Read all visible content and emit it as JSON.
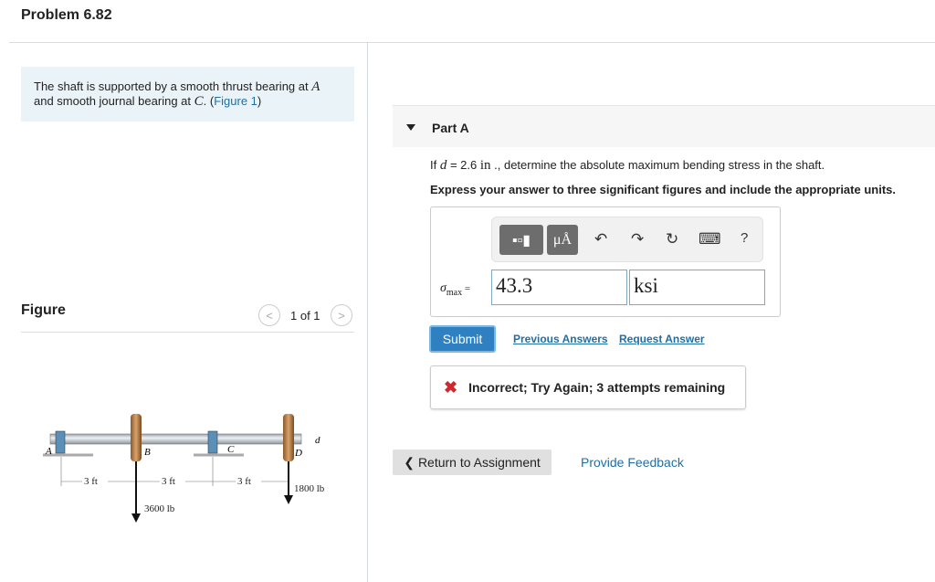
{
  "header": {
    "title": "Problem 6.82"
  },
  "intro": {
    "text_1": "The shaft is supported by a smooth thrust bearing at ",
    "A": "A",
    "text_2": " and smooth journal bearing at ",
    "C": "C",
    "text_3": ". (",
    "figure_link": "Figure 1",
    "text_4": ")"
  },
  "figure": {
    "label": "Figure",
    "pager": "1 of 1",
    "prev": "<",
    "next": ">",
    "labels": {
      "A": "A",
      "B": "B",
      "C": "C",
      "D": "D",
      "d": "d",
      "dim1": "3 ft",
      "dim2": "3 ft",
      "dim3": "3 ft",
      "load_B": "3600 lb",
      "load_D": "1800 lb"
    }
  },
  "part_a": {
    "title": "Part A",
    "question_1": "If ",
    "d_var": "d",
    "question_2": " = 2.6 ",
    "unit_in": "in",
    "question_3": " ., determine the absolute maximum bending stress in the shaft.",
    "instruction": "Express your answer to three significant figures and include the appropriate units.",
    "toolbar": {
      "templates": "templates-icon",
      "units": "μÅ",
      "undo": "↶",
      "redo": "↷",
      "reset": "↻",
      "keyboard": "⌨",
      "help": "?"
    },
    "symbol": "σ",
    "subscript": "max",
    "equals": " =",
    "value": "43.3",
    "units_value": "ksi",
    "submit": "Submit",
    "previous_answers": "Previous Answers",
    "request_answer": "Request Answer",
    "feedback_icon": "✖",
    "feedback": "Incorrect; Try Again; 3 attempts remaining"
  },
  "footer": {
    "return": "Return to Assignment",
    "return_icon": "❮",
    "provide_feedback": "Provide Feedback"
  },
  "colors": {
    "link": "#1f6fa6",
    "submit": "#2f80c0",
    "error": "#d0282e"
  }
}
